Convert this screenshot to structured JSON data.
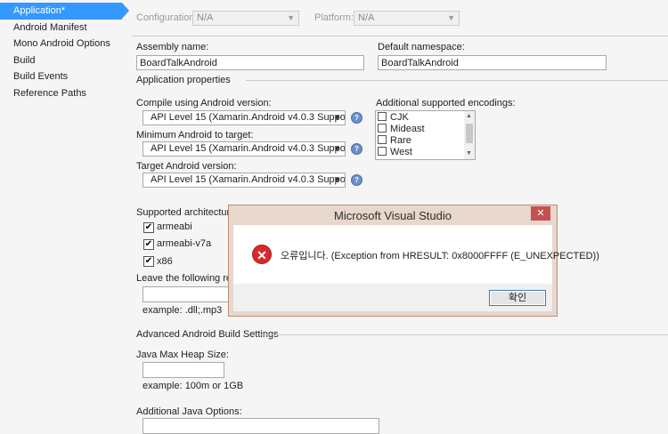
{
  "sidebar": {
    "items": [
      {
        "label": "Application*",
        "active": true
      },
      {
        "label": "Android Manifest"
      },
      {
        "label": "Mono Android Options"
      },
      {
        "label": "Build"
      },
      {
        "label": "Build Events"
      },
      {
        "label": "Reference Paths"
      }
    ]
  },
  "top": {
    "configuration_label": "Configuration:",
    "configuration_value": "N/A",
    "platform_label": "Platform:",
    "platform_value": "N/A"
  },
  "assembly": {
    "label": "Assembly name:",
    "value": "BoardTalkAndroid"
  },
  "namespace": {
    "label": "Default namespace:",
    "value": "BoardTalkAndroid"
  },
  "app_props": {
    "header": "Application properties",
    "compile": {
      "label": "Compile using Android version:",
      "value": "API Level 15 (Xamarin.Android v4.0.3 Support)"
    },
    "min": {
      "label": "Minimum Android to target:",
      "value": "API Level 15 (Xamarin.Android v4.0.3 Support)"
    },
    "target": {
      "label": "Target Android version:",
      "value": "API Level 15 (Xamarin.Android v4.0.3 Support)"
    }
  },
  "encodings": {
    "label": "Additional supported encodings:",
    "items": [
      "CJK",
      "Mideast",
      "Rare",
      "West"
    ]
  },
  "architectures": {
    "label": "Supported architectures:",
    "items": [
      {
        "label": "armeabi",
        "checked": true
      },
      {
        "label": "armeabi-v7a",
        "checked": true
      },
      {
        "label": "x86",
        "checked": true
      }
    ]
  },
  "leave": {
    "label": "Leave the following resou",
    "example": "example: .dll;.mp3"
  },
  "advanced": {
    "header": "Advanced Android Build Settings"
  },
  "heap": {
    "label": "Java Max Heap Size:",
    "example": "example: 100m or 1GB"
  },
  "java_options": {
    "label": "Additional Java Options:"
  },
  "icons": {
    "help": "help-icon",
    "error": "error-icon",
    "close": "close-icon",
    "check": "✔",
    "dropdown": "▼"
  },
  "dialog": {
    "title": "Microsoft Visual Studio",
    "close_glyph": "✕",
    "message": "오류입니다. (Exception from HRESULT: 0x8000FFFF (E_UNEXPECTED))",
    "error_glyph": "✕",
    "ok_label": "확인"
  },
  "colors": {
    "accent": "#3399ff",
    "dialog_frame": "#e8d7cc",
    "close": "#c75050",
    "error": "#d72b2b"
  }
}
